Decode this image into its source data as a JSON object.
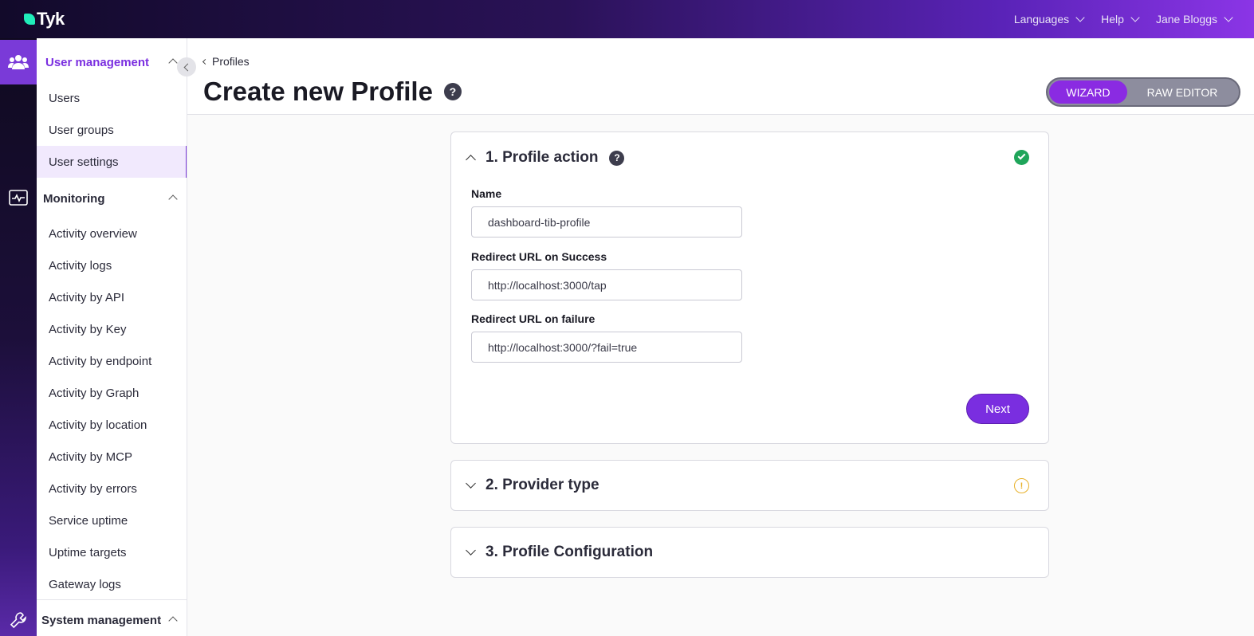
{
  "topbar": {
    "logo_text": "Tyk",
    "nav": [
      {
        "label": "Languages"
      },
      {
        "label": "Help"
      },
      {
        "label": "Jane Bloggs"
      }
    ]
  },
  "rail": {
    "items": [
      {
        "icon": "users-icon",
        "active": true
      },
      {
        "icon": "monitoring-icon",
        "active": false
      },
      {
        "icon": "wrench-icon",
        "active": false
      }
    ]
  },
  "sidebar": {
    "sections": [
      {
        "label": "User management",
        "color": "#7a2ee0",
        "items": [
          "Users",
          "User groups",
          "User settings"
        ]
      },
      {
        "label": "Monitoring",
        "items": [
          "Activity overview",
          "Activity logs",
          "Activity by API",
          "Activity by Key",
          "Activity by endpoint",
          "Activity by Graph",
          "Activity by location",
          "Activity by MCP",
          "Activity by errors",
          "Service uptime",
          "Uptime targets",
          "Gateway logs"
        ]
      },
      {
        "label": "System management",
        "items": []
      }
    ],
    "active_item": "User settings"
  },
  "header": {
    "breadcrumb": "Profiles",
    "title": "Create new Profile",
    "help": "?",
    "toggle": {
      "on": "WIZARD",
      "off": "RAW EDITOR"
    }
  },
  "steps": [
    {
      "title": "1. Profile action",
      "help": "?",
      "status": "complete",
      "expanded": true,
      "fields": [
        {
          "label": "Name",
          "value": "dashboard-tib-profile"
        },
        {
          "label": "Redirect URL on Success",
          "value": "http://localhost:3000/tap"
        },
        {
          "label": "Redirect URL on failure",
          "value": "http://localhost:3000/?fail=true"
        }
      ],
      "next_label": "Next"
    },
    {
      "title": "2. Provider type",
      "status": "warning",
      "status_glyph": "!",
      "expanded": false
    },
    {
      "title": "3. Profile Configuration",
      "expanded": false
    }
  ],
  "colors": {
    "accent": "#7a2ee0",
    "success": "#1fa55a",
    "warning": "#e8b12a"
  }
}
